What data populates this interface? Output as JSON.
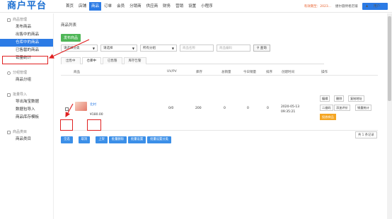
{
  "header": {
    "logo": "商户平台",
    "nav": [
      "首页",
      "店铺",
      "商品",
      "订单",
      "会员",
      "分销商",
      "供应商",
      "财务",
      "营销",
      "设置",
      "小程序"
    ],
    "active_index": 2,
    "expire_text": "有效期至：2023...",
    "shop_name": "捷尔圆侍者店铺",
    "user_button": "用户"
  },
  "sidebar": {
    "sections": [
      {
        "title": "商品管理",
        "items": [
          "发布商品",
          "出售中的商品",
          "仓库中的商品",
          "已售罄的商品",
          "销量统计"
        ]
      },
      {
        "title": "分组管理",
        "items": [
          "商品分组"
        ]
      },
      {
        "title": "批量导入",
        "items": [
          "导出淘宝数据",
          "数据包导入",
          "商品库存模板"
        ]
      },
      {
        "title": "商品类目",
        "items": [
          "商品类目"
        ]
      }
    ],
    "active_item": "仓库中的商品"
  },
  "main": {
    "breadcrumb": "商品列表",
    "publish_button": "发布商品",
    "filters": {
      "category": "请选择分类",
      "group": "请选择",
      "status": "所有分组",
      "name_placeholder": "商品名称",
      "code_placeholder": "商品编码",
      "search_button": "查询"
    },
    "tabs": [
      "出售中",
      "仓库中",
      "已售罄",
      "库存告警"
    ],
    "active_tab": 1,
    "columns": [
      "商品",
      "UV/PV",
      "库存",
      "总销量",
      "今日销量",
      "排序",
      "创建时间",
      "操作"
    ],
    "row": {
      "name": "北村",
      "price": "¥180.00",
      "uvpv": "0/0",
      "stock": "200",
      "total_sales": "0",
      "today_sales": "0",
      "sort": "0",
      "created_date": "2020-05-13",
      "created_time": "09:35:21",
      "ops": [
        "编辑",
        "删除",
        "复制地址",
        "二维码",
        "添加评价",
        "销量统计",
        "投放商品"
      ]
    },
    "bulk_actions": [
      "全选",
      "取消",
      "上架",
      "批量删除",
      "批量设置",
      "批量设置分类"
    ],
    "pager": "共 1 条记录"
  },
  "colors": {
    "primary": "#2c7be5",
    "green": "#4fb657",
    "orange": "#f5a623",
    "annotation_red": "#e02020"
  }
}
